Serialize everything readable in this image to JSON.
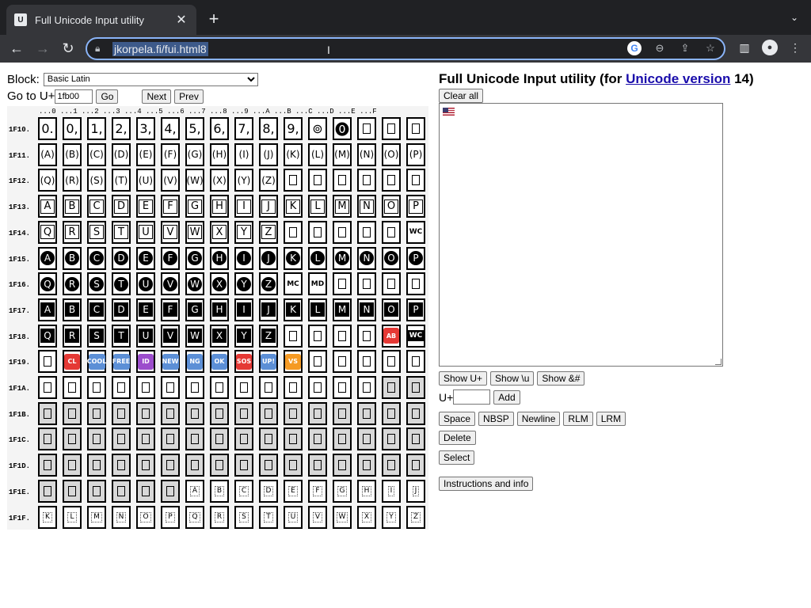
{
  "browser": {
    "tab_title": "Full Unicode Input utility",
    "favicon_text": "U",
    "url": "jkorpela.fi/fui.html8"
  },
  "page": {
    "block_label": "Block:",
    "block_selected": "Basic Latin",
    "goto_label": "Go to U+",
    "goto_value": "1fb00",
    "go_button": "Go",
    "next_button": "Next",
    "prev_button": "Prev",
    "column_headers": "...0 ...1 ...2 ...3 ...4 ...5 ...6 ...7 ...8 ...9 ...A ...B ...C ...D ...E ...F",
    "row_labels": [
      "1F10.",
      "1F11.",
      "1F12.",
      "1F13.",
      "1F14.",
      "1F15.",
      "1F16.",
      "1F17.",
      "1F18.",
      "1F19.",
      "1F1A.",
      "1F1B.",
      "1F1C.",
      "1F1D.",
      "1F1E.",
      "1F1F."
    ],
    "rows": [
      [
        "0.",
        "0,",
        "1,",
        "2,",
        "3,",
        "4,",
        "5,",
        "6,",
        "7,",
        "8,",
        "9,",
        "⊚",
        "⓿",
        "▯",
        "▯",
        "▯"
      ],
      [
        "(A)",
        "(B)",
        "(C)",
        "(D)",
        "(E)",
        "(F)",
        "(G)",
        "(H)",
        "(I)",
        "(J)",
        "(K)",
        "(L)",
        "(M)",
        "(N)",
        "(O)",
        "(P)"
      ],
      [
        "(Q)",
        "(R)",
        "(S)",
        "(T)",
        "(U)",
        "(V)",
        "(W)",
        "(X)",
        "(Y)",
        "(Z)",
        "▯",
        "▯",
        "▯",
        "▯",
        "▯",
        "▯"
      ],
      [
        "A",
        "B",
        "C",
        "D",
        "E",
        "F",
        "G",
        "H",
        "I",
        "J",
        "K",
        "L",
        "M",
        "N",
        "O",
        "P"
      ],
      [
        "Q",
        "R",
        "S",
        "T",
        "U",
        "V",
        "W",
        "X",
        "Y",
        "Z",
        "▯",
        "▯",
        "▯",
        "▯",
        "▯",
        "WC"
      ],
      [
        "A",
        "B",
        "C",
        "D",
        "E",
        "F",
        "G",
        "H",
        "I",
        "J",
        "K",
        "L",
        "M",
        "N",
        "O",
        "P"
      ],
      [
        "Q",
        "R",
        "S",
        "T",
        "U",
        "V",
        "W",
        "X",
        "Y",
        "Z",
        "MC",
        "MD",
        "▯",
        "▯",
        "▯",
        "▯"
      ],
      [
        "A",
        "B",
        "C",
        "D",
        "E",
        "F",
        "G",
        "H",
        "I",
        "J",
        "K",
        "L",
        "M",
        "N",
        "O",
        "P"
      ],
      [
        "Q",
        "R",
        "S",
        "T",
        "U",
        "V",
        "W",
        "X",
        "Y",
        "Z",
        "▯",
        "▯",
        "▯",
        "▯",
        "AB",
        "WC"
      ],
      [
        "▯",
        "CL",
        "COOL",
        "FREE",
        "ID",
        "NEW",
        "NG",
        "OK",
        "SOS",
        "UP!",
        "VS",
        "▯",
        "▯",
        "▯",
        "▯",
        "▯"
      ],
      [
        "▯",
        "▯",
        "▯",
        "▯",
        "▯",
        "▯",
        "▯",
        "▯",
        "▯",
        "▯",
        "▯",
        "▯",
        "▯",
        "▯",
        "▯",
        "▯"
      ],
      [
        "▯",
        "▯",
        "▯",
        "▯",
        "▯",
        "▯",
        "▯",
        "▯",
        "▯",
        "▯",
        "▯",
        "▯",
        "▯",
        "▯",
        "▯",
        "▯"
      ],
      [
        "▯",
        "▯",
        "▯",
        "▯",
        "▯",
        "▯",
        "▯",
        "▯",
        "▯",
        "▯",
        "▯",
        "▯",
        "▯",
        "▯",
        "▯",
        "▯"
      ],
      [
        "▯",
        "▯",
        "▯",
        "▯",
        "▯",
        "▯",
        "▯",
        "▯",
        "▯",
        "▯",
        "▯",
        "▯",
        "▯",
        "▯",
        "▯",
        "▯"
      ],
      [
        "▯",
        "▯",
        "▯",
        "▯",
        "▯",
        "▯",
        "A",
        "B",
        "C",
        "D",
        "E",
        "F",
        "G",
        "H",
        "I",
        "J"
      ],
      [
        "K",
        "L",
        "M",
        "N",
        "O",
        "P",
        "Q",
        "R",
        "S",
        "T",
        "U",
        "V",
        "W",
        "X",
        "Y",
        "Z"
      ]
    ],
    "title_prefix": "Full Unicode Input utility (for ",
    "title_link": "Unicode version",
    "title_suffix": " 14)",
    "clear_all": "Clear all",
    "show_uplus": "Show U+",
    "show_u": "Show \\u",
    "show_amp": "Show &#",
    "uplus_label": "U+",
    "add_button": "Add",
    "space_button": "Space",
    "nbsp_button": "NBSP",
    "newline_button": "Newline",
    "rlm_button": "RLM",
    "lrm_button": "LRM",
    "delete_button": "Delete",
    "select_button": "Select",
    "instructions_button": "Instructions and info"
  }
}
